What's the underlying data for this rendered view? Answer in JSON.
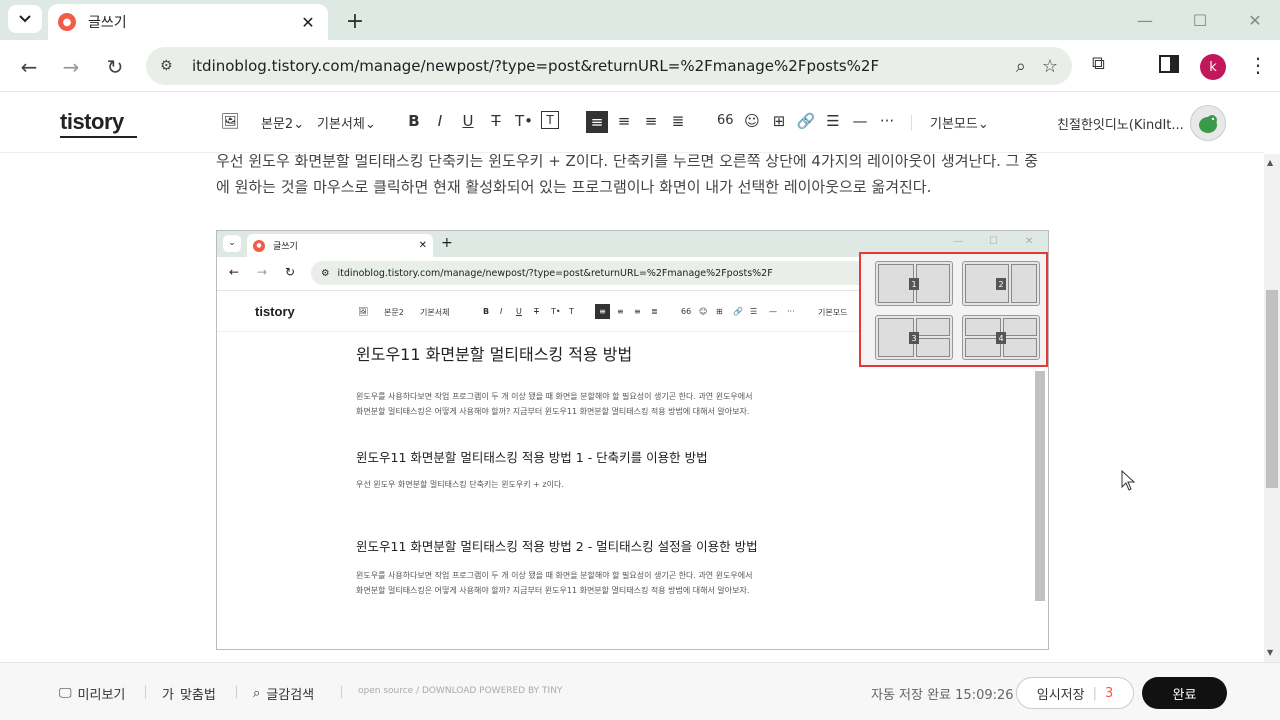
{
  "browser": {
    "tab_title": "글쓰기",
    "url": "itdinoblog.tistory.com/manage/newpost/?type=post&returnURL=%2Fmanage%2Fposts%2F",
    "profile_initial": "k"
  },
  "editor": {
    "logo": "tistory",
    "toolbar": {
      "heading": "본문2",
      "font": "기본서체",
      "quote": "66",
      "mode": "기본모드"
    },
    "user_name": "친절한잇디노(KindIt..."
  },
  "content": {
    "paragraph": "우선 윈도우 화면분할 멀티태스킹 단축키는 윈도우키 + Z이다. 단축키를 누르면 오른쪽 상단에 4가지의 레이아웃이 생겨난다. 그 중에 원하는 것을 마우스로 클릭하면 현재 활성화되어 있는 프로그램이나 화면이 내가 선택한 레이아웃으로 옮겨진다.",
    "embed": {
      "tab_title": "글쓰기",
      "url": "itdinoblog.tistory.com/manage/newpost/?type=post&returnURL=%2Fmanage%2Fposts%2F",
      "logo": "tistory",
      "heading_style": "본문2",
      "font": "기본서체",
      "mode": "기본모드",
      "title": "윈도우11 화면분할 멀티태스킹 적용 방법",
      "intro": [
        "윈도우를 사용하다보면 작업 프로그램이 두 개 이상 됐을 때 화면을 분할해야 할 필요성이 생기곤 한다. 과연 윈도우에서",
        "화면분할 멀티태스킹은 어떻게 사용해야 할까? 지금부터 윈도우11 화면분할 멀티태스킹 적용 방법에 대해서 알아보자."
      ],
      "h1": "윈도우11 화면분할 멀티태스킹 적용 방법 1 - 단축키를 이용한 방법",
      "p1": "우선 윈도우 화면분할 멀티태스킹 단축키는 윈도우키 + z이다.",
      "h2": "윈도우11 화면분할 멀티태스킹 적용 방법 2 - 멀티태스킹 설정을 이용한 방법",
      "p2": [
        "윈도우를 사용하다보면 작업 프로그램이 두 개 이상 됐을 때 화면을 분할해야 할 필요성이 생기곤 한다. 과연 윈도우에서",
        "화면분할 멀티태스킹은 어떻게 사용해야 할까? 지금부터 윈도우11 화면분할 멀티태스킹 적용 방법에 대해서 알아보자."
      ],
      "snap_labels": [
        "1",
        "2",
        "3",
        "4"
      ]
    }
  },
  "bottombar": {
    "preview": "미리보기",
    "spellcheck": "맞춤법",
    "search": "글감검색",
    "powered": "open source / DOWNLOAD    POWERED BY TINY",
    "autosave": "자동 저장 완료 15:09:26",
    "draft_label": "임시저장",
    "draft_count": "3",
    "done": "완료"
  }
}
